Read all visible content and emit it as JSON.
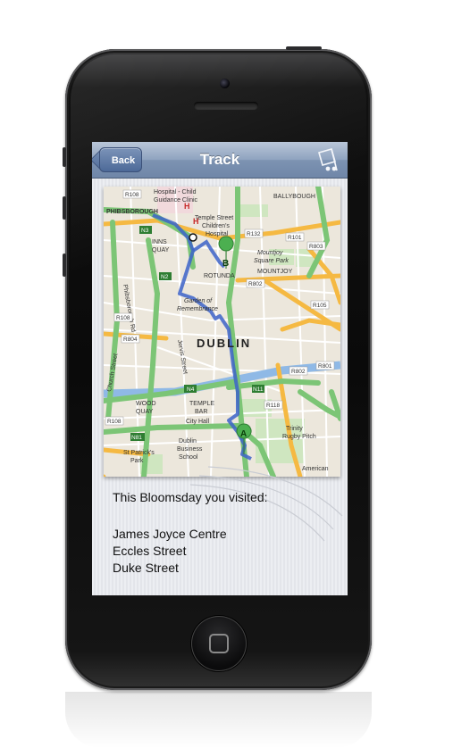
{
  "navbar": {
    "back_label": "Back",
    "title": "Track"
  },
  "map": {
    "labels": {
      "hospital_child": "Hospital - Child",
      "guidance_clinic": "Guidance Clinic",
      "r108_top": "R108",
      "ballybough": "BALLYBOUGH",
      "phibsborough": "PHIBSBOROUGH",
      "temple_street": "Temple Street",
      "childrens": "Children's",
      "hospital": "Hospital",
      "r132": "R132",
      "r101": "R101",
      "r803": "R803",
      "mountjoy_sq": "Mountjoy",
      "square_park": "Square Park",
      "mountjoy": "MOUNTJOY",
      "rotunda": "ROTUNDA",
      "r802": "R802",
      "inns": "INNS",
      "quay": "QUAY",
      "phibsborough_rd": "Phibsborough Rd",
      "garden": "Garden of",
      "remembrance": "Remembrance",
      "r105": "R105",
      "r108_left": "R108",
      "r804": "R804",
      "dublin": "DUBLIN",
      "jervis": "Jervis Street",
      "church": "Church Street",
      "r802_b": "R802",
      "r801": "R801",
      "n4": "N4",
      "n11": "N11",
      "r118": "R118",
      "wood": "WOOD",
      "quay2": "QUAY",
      "temple": "TEMPLE",
      "bar": "BAR",
      "city_hall": "City Hall",
      "trinity": "Trinity",
      "rugby_pitch": "Rugby Pitch",
      "r108_b": "R108",
      "n81": "N81",
      "dublin_business": "Dublin",
      "business": "Business",
      "school": "School",
      "st_patricks": "St Patrick's",
      "park": "Park",
      "american": "American",
      "n2": "N2",
      "n3": "N3",
      "hospital_h": "H",
      "marker_a": "A",
      "marker_b": "B"
    }
  },
  "visited": {
    "heading": "This Bloomsday you visited:",
    "places": [
      "James Joyce Centre",
      "Eccles Street",
      "Duke Street"
    ]
  },
  "colors": {
    "nav_top": "#b9c6d8",
    "nav_bottom": "#6f86a8",
    "route": "#3d63c9",
    "major_road": "#f5b942",
    "green_road": "#7cc576",
    "river": "#8fb9e6"
  }
}
